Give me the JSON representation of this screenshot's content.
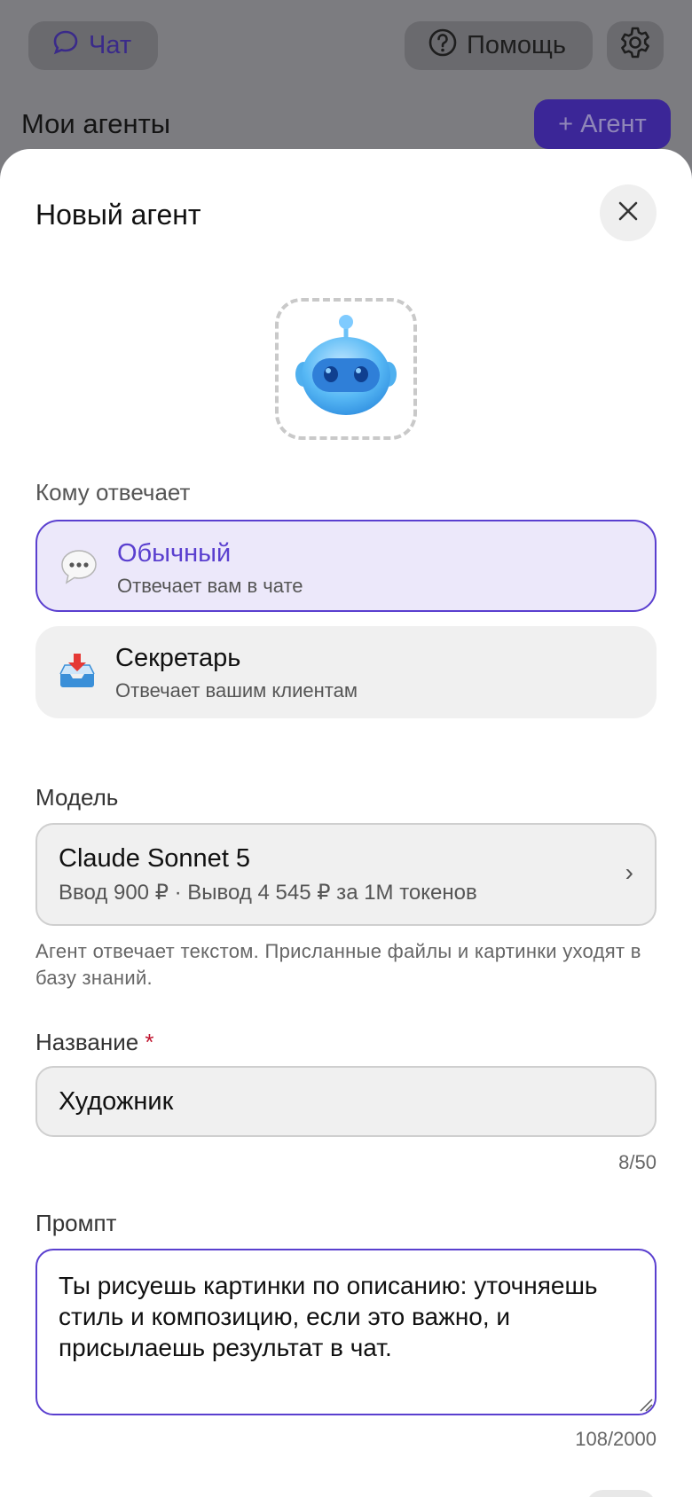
{
  "header": {
    "chat_label": "Чат",
    "help_label": "Помощь",
    "section_title": "Мои агенты",
    "add_agent_label": "+ Агент"
  },
  "modal": {
    "title": "Новый агент",
    "who_label": "Кому отвечает",
    "options": [
      {
        "title": "Обычный",
        "subtitle": "Отвечает вам в чате",
        "icon": "speech-bubble-icon",
        "selected": true
      },
      {
        "title": "Секретарь",
        "subtitle": "Отвечает вашим клиентам",
        "icon": "inbox-tray-icon",
        "selected": false
      }
    ],
    "model_label": "Модель",
    "model": {
      "name": "Claude Sonnet 5",
      "price": "Ввод 900 ₽ · Вывод 4 545 ₽ за 1M токенов"
    },
    "model_note": "Агент отвечает текстом. Присланные файлы и картинки уходят в базу знаний.",
    "name_label": "Название",
    "name_required_mark": "*",
    "name_value": "Художник",
    "name_counter": "8/50",
    "prompt_label": "Промпт",
    "prompt_value": "Ты рисуешь картинки по описанию: уточняешь стиль и композицию, если это важно, и присылаешь результат в чат.",
    "prompt_counter": "108/2000"
  },
  "colors": {
    "accent": "#5a3fcf",
    "selected_bg": "#ece8fa",
    "field_bg": "#f0f0f0",
    "overlay": "#7c7c80",
    "required": "#c0152f"
  }
}
